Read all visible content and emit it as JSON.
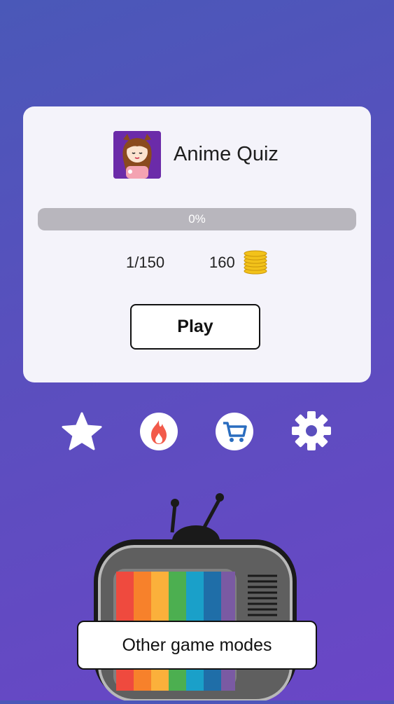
{
  "quiz": {
    "title": "Anime Quiz",
    "progress_text": "0%",
    "progress_value": 0,
    "level_count": "1/150",
    "coins": "160",
    "play_label": "Play"
  },
  "menu": {
    "icons": [
      "star-icon",
      "fire-icon",
      "cart-icon",
      "gear-icon"
    ]
  },
  "footer": {
    "other_modes_label": "Other game modes"
  },
  "colors": {
    "background_top": "#4a58b8",
    "background_bottom": "#6a46c6",
    "card": "#f4f3fa",
    "fire": "#f25a4a",
    "cart": "#2a6dbf",
    "coin": "#f2c21a"
  }
}
